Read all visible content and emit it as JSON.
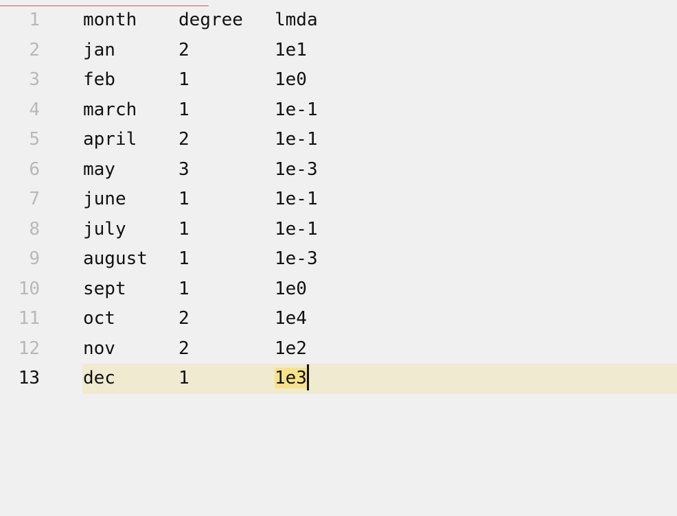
{
  "editor": {
    "current_line": 13,
    "accent_line_color": "#d9534f",
    "current_line_bg": "#efead0",
    "selection_bg": "#f7e28a",
    "rows": [
      {
        "num": "1",
        "month": "month",
        "degree": "degree",
        "lmda": "lmda"
      },
      {
        "num": "2",
        "month": "jan",
        "degree": "2",
        "lmda": "1e1"
      },
      {
        "num": "3",
        "month": "feb",
        "degree": "1",
        "lmda": "1e0"
      },
      {
        "num": "4",
        "month": "march",
        "degree": "1",
        "lmda": "1e-1"
      },
      {
        "num": "5",
        "month": "april",
        "degree": "2",
        "lmda": "1e-1"
      },
      {
        "num": "6",
        "month": "may",
        "degree": "3",
        "lmda": "1e-3"
      },
      {
        "num": "7",
        "month": "june",
        "degree": "1",
        "lmda": "1e-1"
      },
      {
        "num": "8",
        "month": "july",
        "degree": "1",
        "lmda": "1e-1"
      },
      {
        "num": "9",
        "month": "august",
        "degree": "1",
        "lmda": "1e-3"
      },
      {
        "num": "10",
        "month": "sept",
        "degree": "1",
        "lmda": "1e0"
      },
      {
        "num": "11",
        "month": "oct",
        "degree": "2",
        "lmda": "1e4"
      },
      {
        "num": "12",
        "month": "nov",
        "degree": "2",
        "lmda": "1e2"
      },
      {
        "num": "13",
        "month": "dec",
        "degree": "1",
        "lmda": "1e3"
      }
    ]
  }
}
